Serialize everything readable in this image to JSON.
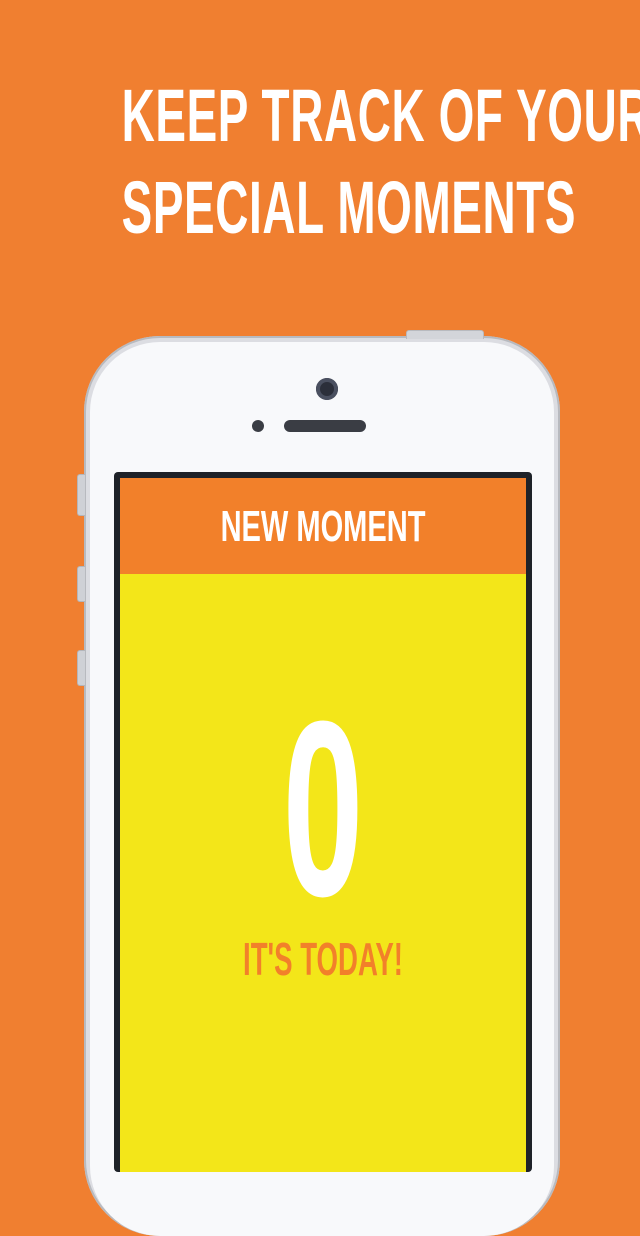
{
  "headline": {
    "line1": "KEEP TRACK OF YOUR",
    "line2": "SPECIAL MOMENTS"
  },
  "app": {
    "header_title": "NEW MOMENT",
    "day_count": "0",
    "caption": "IT'S TODAY!"
  },
  "colors": {
    "background": "#F07F30",
    "header": "#F2802A",
    "screen": "#F3E619",
    "text_light": "#FFFFFF"
  }
}
